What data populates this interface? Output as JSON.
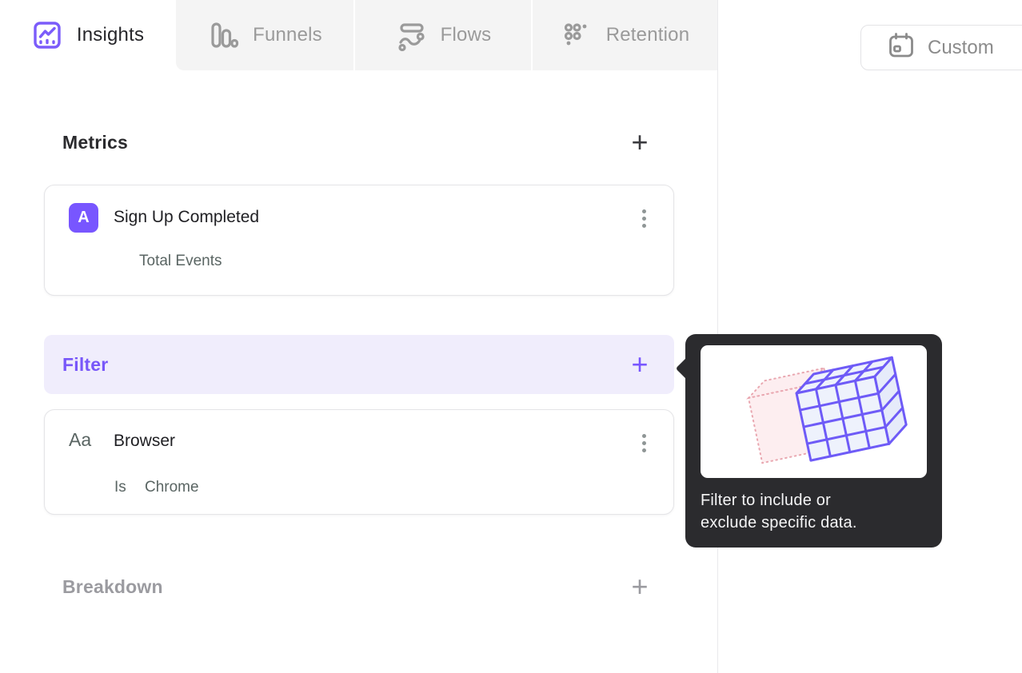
{
  "colors": {
    "accent_purple": "#7856FF",
    "filter_row_bg": "#F0EDFC",
    "inactive_tab_bg": "#F4F4F4",
    "tooltip_bg": "#2B2B2E",
    "card_border": "#E4E4E7",
    "muted_text": "#5A6563",
    "gray_text": "#9A9A9A",
    "pink_cube_stroke": "#E9A7B0",
    "purple_cube_stroke": "#6E5BF7"
  },
  "tabs": [
    {
      "label": "Insights",
      "icon": "insights-chart-icon",
      "active": true
    },
    {
      "label": "Funnels",
      "icon": "funnels-bars-icon",
      "active": false
    },
    {
      "label": "Flows",
      "icon": "flows-stream-icon",
      "active": false
    },
    {
      "label": "Retention",
      "icon": "retention-dots-icon",
      "active": false
    }
  ],
  "toolbar": {
    "custom_label": "Custom",
    "icon": "calendar-icon"
  },
  "metrics": {
    "title": "Metrics",
    "add_icon": "+",
    "card": {
      "badge": "A",
      "title": "Sign Up Completed",
      "subtitle": "Total Events",
      "menu_icon": "kebab-menu-icon"
    }
  },
  "filter": {
    "label": "Filter",
    "add_icon": "+",
    "card": {
      "icon_label": "Aa",
      "title": "Browser",
      "operator": "Is",
      "value": "Chrome",
      "menu_icon": "kebab-menu-icon"
    }
  },
  "breakdown": {
    "label": "Breakdown",
    "add_icon": "+"
  },
  "tooltip": {
    "line1": "Filter to include or",
    "line2": "exclude specific data.",
    "illustration": "filter-cube-illustration"
  }
}
